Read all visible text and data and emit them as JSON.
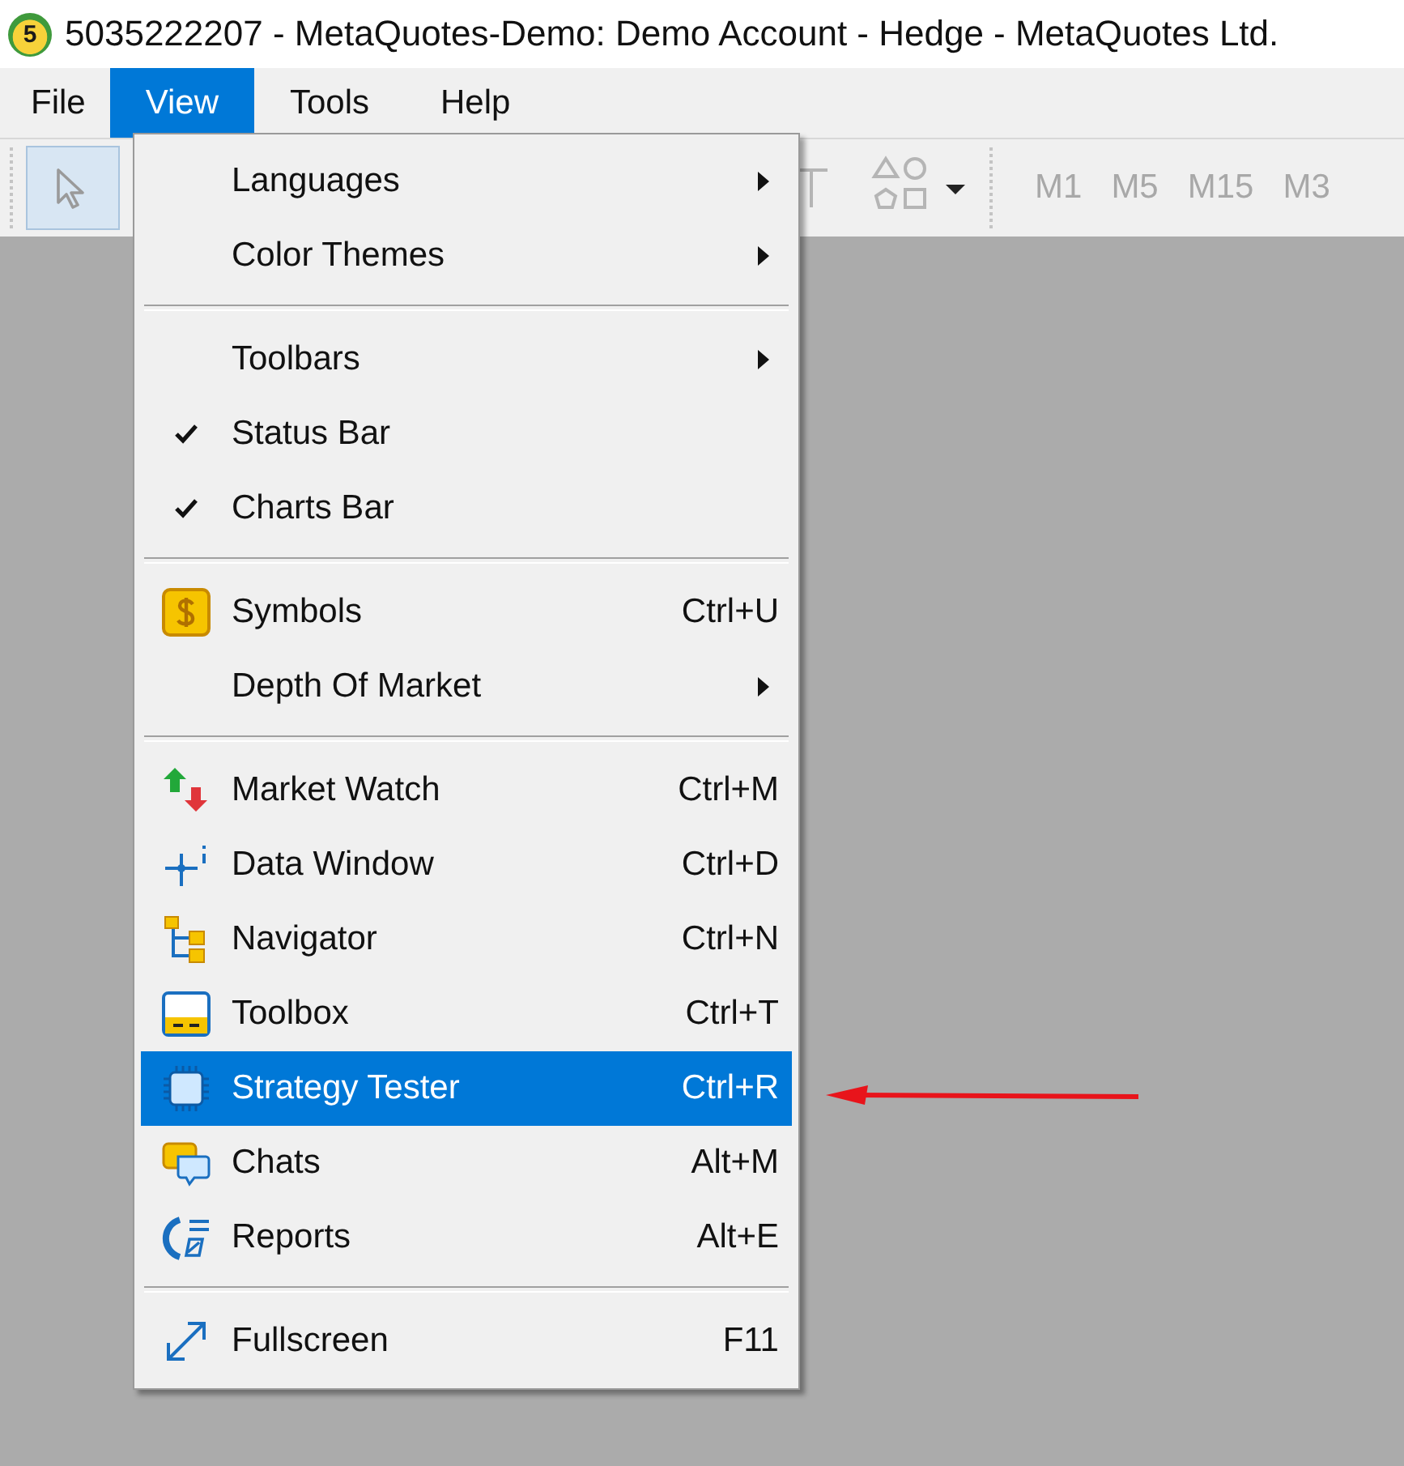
{
  "window": {
    "title": "5035222207 - MetaQuotes-Demo: Demo Account - Hedge - MetaQuotes Ltd.",
    "logo_text": "5"
  },
  "menu_bar": [
    {
      "label": "File",
      "selected": false
    },
    {
      "label": "View",
      "selected": true
    },
    {
      "label": "Tools",
      "selected": false
    },
    {
      "label": "Help",
      "selected": false
    }
  ],
  "toolbar": {
    "timeframes": [
      "M1",
      "M5",
      "M15",
      "M3"
    ]
  },
  "view_menu": {
    "groups": [
      {
        "items": [
          {
            "label": "Languages",
            "submenu": true,
            "checked": false,
            "selected": false
          },
          {
            "label": "Color Themes",
            "submenu": true,
            "checked": false,
            "selected": false
          }
        ]
      },
      {
        "items": [
          {
            "label": "Toolbars",
            "submenu": true,
            "checked": false,
            "selected": false
          },
          {
            "label": "Status Bar",
            "submenu": false,
            "checked": true,
            "selected": false
          },
          {
            "label": "Charts Bar",
            "submenu": false,
            "checked": true,
            "selected": false
          }
        ]
      },
      {
        "items": [
          {
            "label": "Symbols",
            "kind": "symbols",
            "shortcut": "Ctrl+U",
            "submenu": false,
            "checked": false,
            "selected": false
          },
          {
            "label": "Depth Of Market",
            "submenu": true,
            "checked": false,
            "selected": false
          }
        ]
      },
      {
        "items": [
          {
            "label": "Market Watch",
            "kind": "market",
            "shortcut": "Ctrl+M",
            "submenu": false,
            "checked": false,
            "selected": false
          },
          {
            "label": "Data Window",
            "kind": "data",
            "shortcut": "Ctrl+D",
            "submenu": false,
            "checked": false,
            "selected": false
          },
          {
            "label": "Navigator",
            "kind": "navigator",
            "shortcut": "Ctrl+N",
            "submenu": false,
            "checked": false,
            "selected": false
          },
          {
            "label": "Toolbox",
            "kind": "toolbox",
            "shortcut": "Ctrl+T",
            "submenu": false,
            "checked": false,
            "selected": false
          },
          {
            "label": "Strategy Tester",
            "kind": "tester",
            "shortcut": "Ctrl+R",
            "submenu": false,
            "checked": false,
            "selected": true
          },
          {
            "label": "Chats",
            "kind": "chats",
            "shortcut": "Alt+M",
            "submenu": false,
            "checked": false,
            "selected": false
          },
          {
            "label": "Reports",
            "kind": "reports",
            "shortcut": "Alt+E",
            "submenu": false,
            "checked": false,
            "selected": false
          }
        ]
      },
      {
        "items": [
          {
            "label": "Fullscreen",
            "kind": "fullscreen",
            "shortcut": "F11",
            "submenu": false,
            "checked": false,
            "selected": false
          }
        ]
      }
    ]
  }
}
